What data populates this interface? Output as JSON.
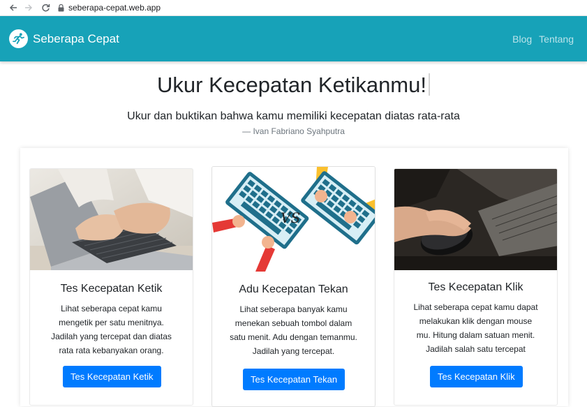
{
  "browser": {
    "url": "seberapa-cepat.web.app",
    "icons": [
      "back-arrow-icon",
      "forward-arrow-icon",
      "reload-icon",
      "lock-icon"
    ]
  },
  "navbar": {
    "brand": "Seberapa Cepat",
    "links": [
      "Blog",
      "Tentang"
    ],
    "color": "#17a2b8"
  },
  "hero": {
    "title": "Ukur Kecepatan Ketikanmu!",
    "quote": "Ukur dan buktikan bahwa kamu memiliki kecepatan diatas rata-rata",
    "author": "— Ivan Fabriano Syahputra"
  },
  "cards": [
    {
      "title": "Tes Kecepatan Ketik",
      "lines": [
        "Lihat seberapa cepat kamu",
        "mengetik per satu menitnya.",
        "Jadilah yang tercepat dan diatas",
        "rata rata kebanyakan orang."
      ],
      "button": "Tes Kecepatan Ketik"
    },
    {
      "title": "Adu Kecepatan Tekan",
      "lines": [
        "Lihat seberapa banyak kamu",
        "menekan sebuah tombol dalam",
        "satu menit. Adu dengan temanmu.",
        "Jadilah yang tercepat."
      ],
      "button": "Tes Kecepatan Tekan",
      "vs_label": "VS"
    },
    {
      "title": "Tes Kecepatan Klik",
      "lines": [
        "Lihat seberapa cepat kamu dapat",
        "melakukan klik dengan mouse",
        "mu. Hitung dalam satuan menit.",
        "Jadilah salah satu tercepat"
      ],
      "button": "Tes Kecepatan Klik"
    }
  ],
  "colors": {
    "primary": "#007bff",
    "navbar": "#17a2b8"
  }
}
